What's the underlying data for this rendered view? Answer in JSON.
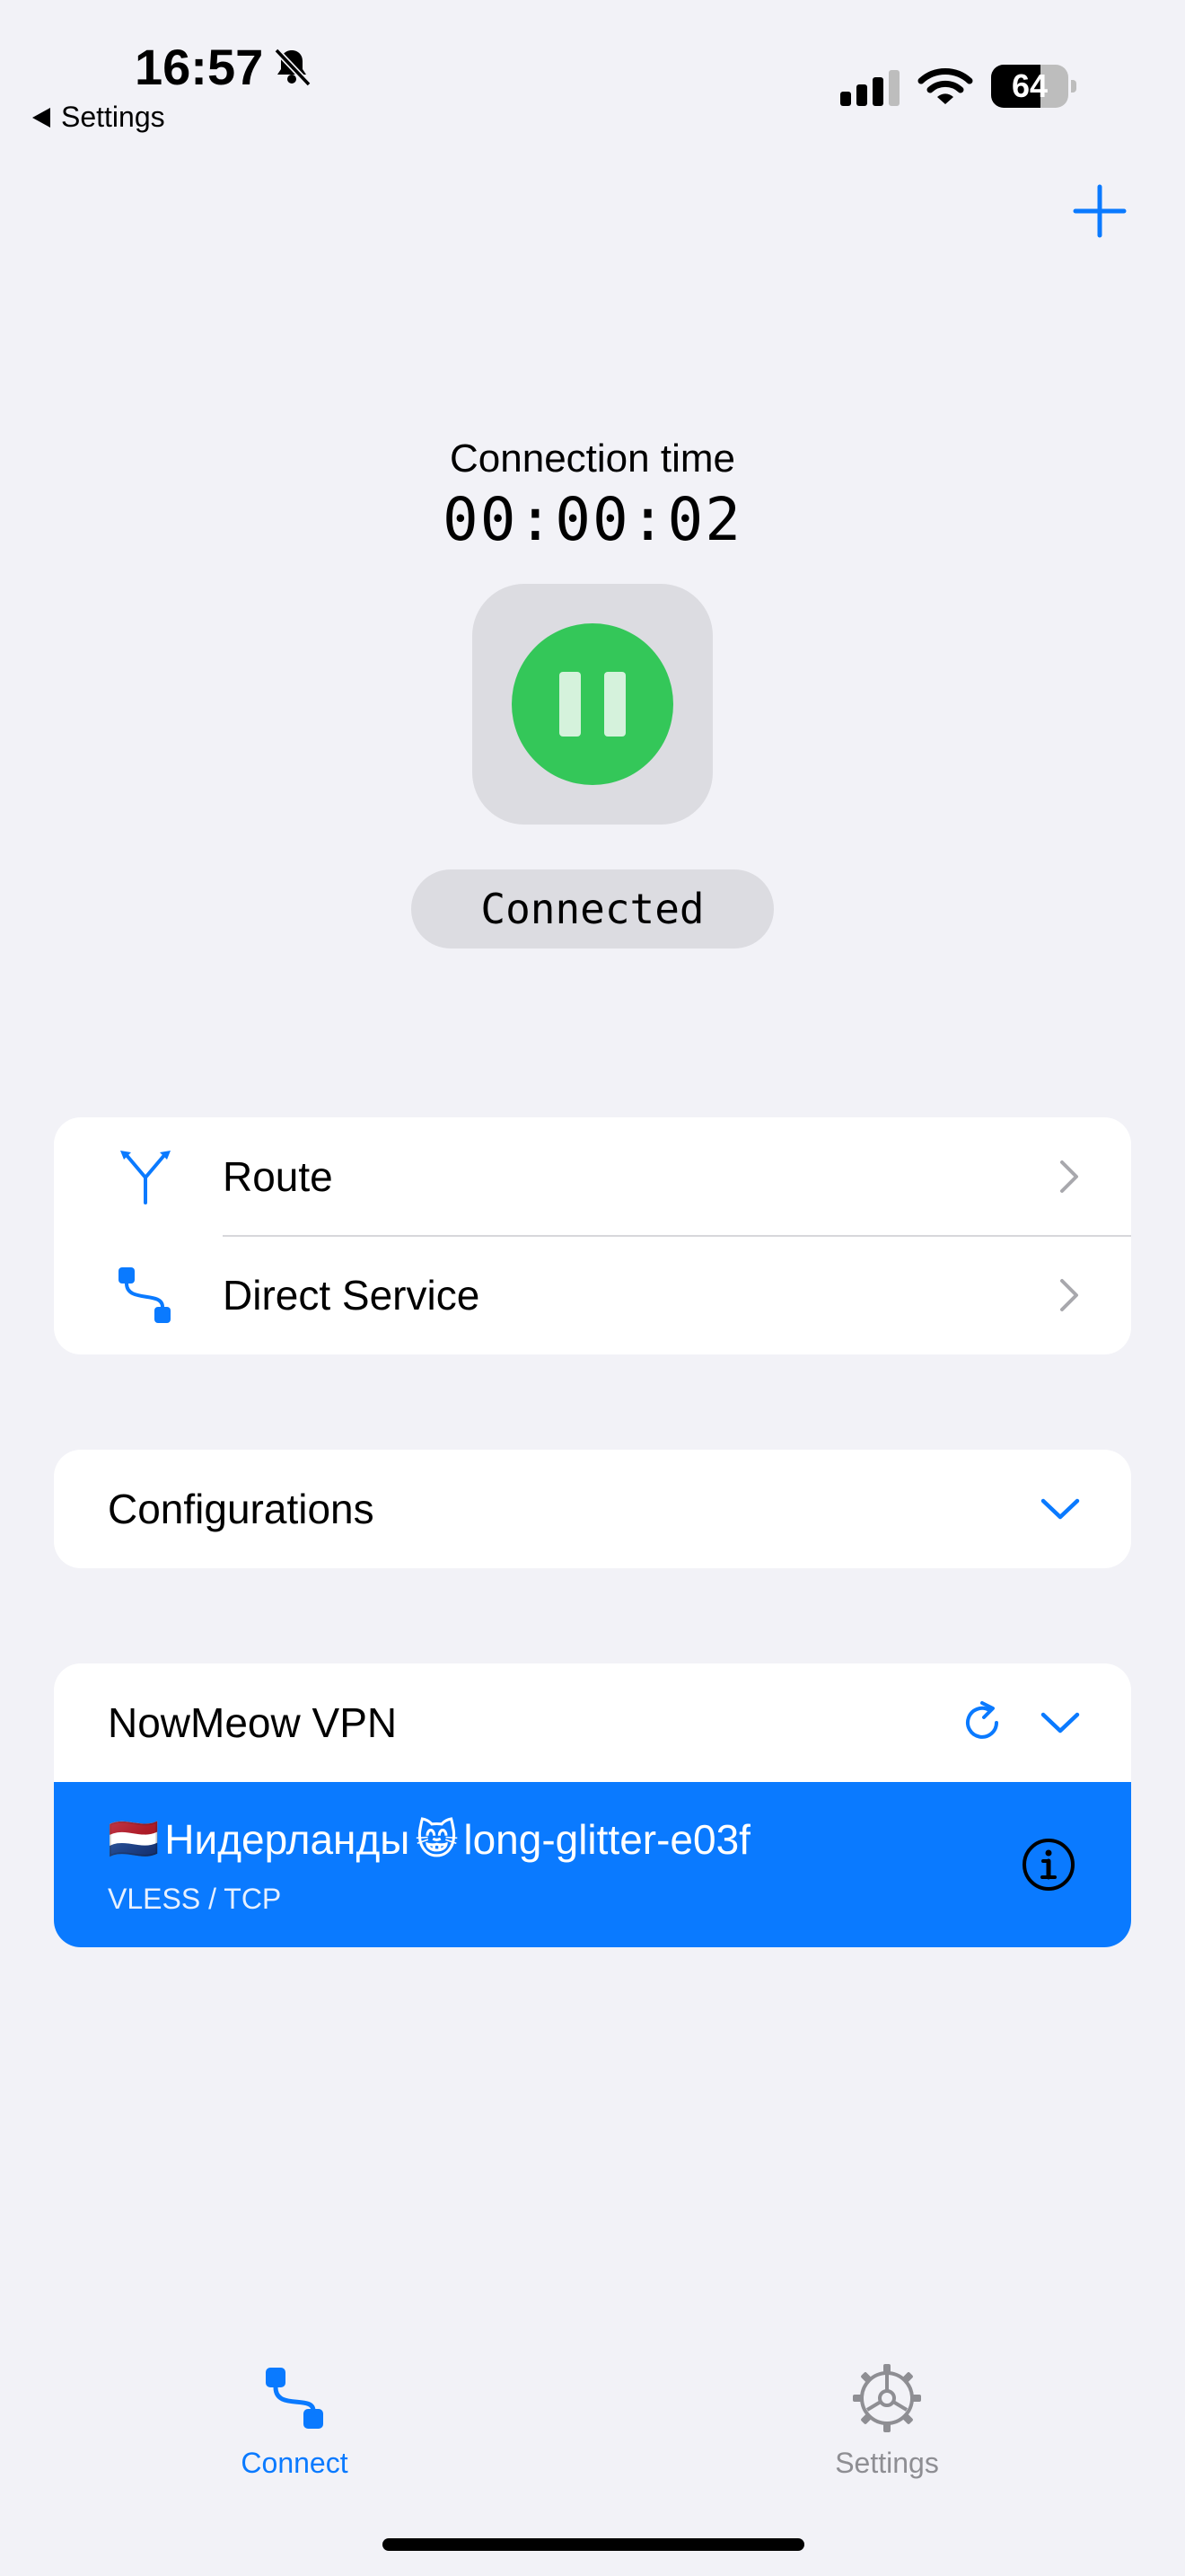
{
  "status_bar": {
    "time": "16:57",
    "back_label": "Settings",
    "battery_level": "64",
    "battery_percent": 64
  },
  "header": {
    "add_icon": "plus-icon"
  },
  "connection": {
    "time_label": "Connection time",
    "time_value": "00:00:02",
    "state": "Connected",
    "toggle_icon": "pause-icon",
    "accent_color": "#34C759"
  },
  "routing": {
    "items": [
      {
        "label": "Route",
        "icon": "route-split-icon"
      },
      {
        "label": "Direct Service",
        "icon": "direct-path-icon"
      }
    ]
  },
  "configurations": {
    "label": "Configurations"
  },
  "subscription": {
    "name": "NowMeow VPN",
    "server": {
      "name": "Нидерланды",
      "flag": "🇳🇱",
      "emoji": "😸",
      "tag": "long-glitter-e03f",
      "protocol": "VLESS / TCP",
      "highlight_color": "#0A7AFF"
    }
  },
  "tab_bar": {
    "tabs": [
      {
        "label": "Connect",
        "icon": "connect-icon",
        "active": true
      },
      {
        "label": "Settings",
        "icon": "gear-icon",
        "active": false
      }
    ],
    "active_color": "#0A7AFF",
    "inactive_color": "#8E8E93"
  }
}
